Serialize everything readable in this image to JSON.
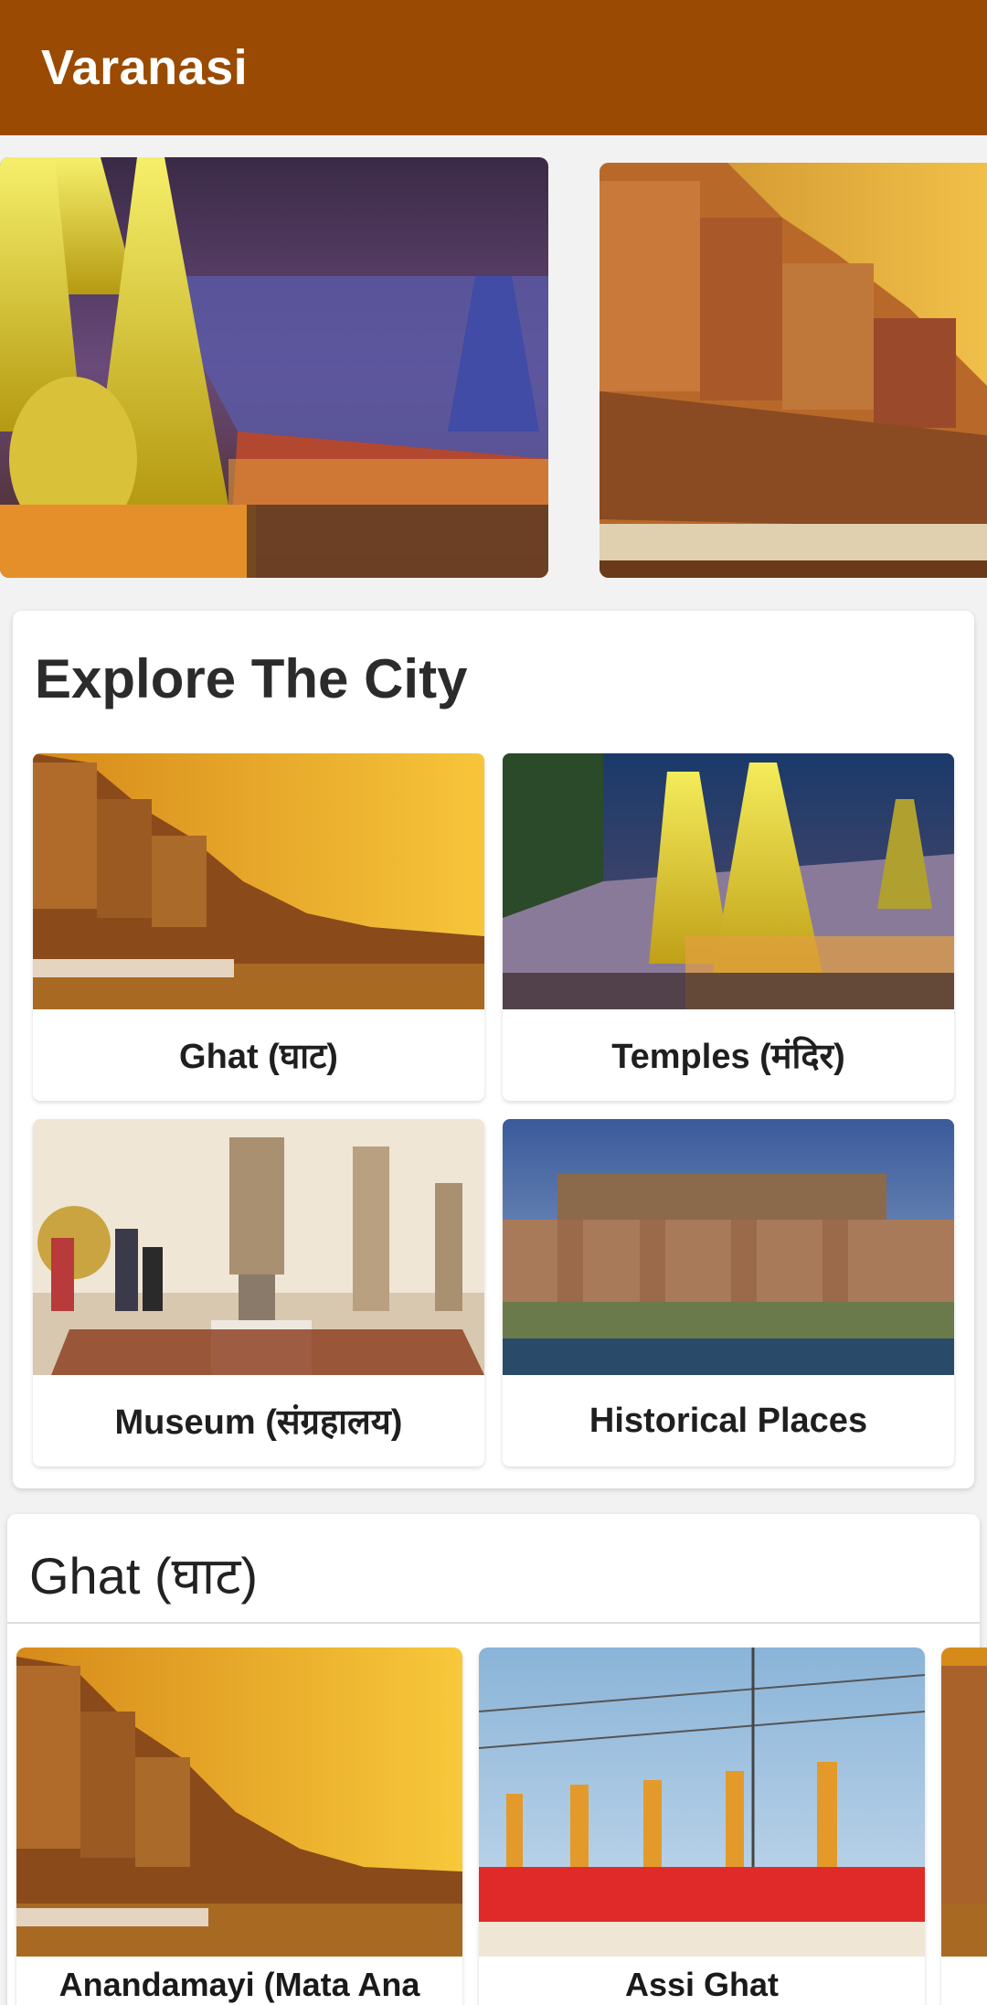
{
  "app_bar": {
    "title": "Varanasi"
  },
  "carousel": {
    "slides": [
      {
        "icon": "temple-night-photo"
      },
      {
        "icon": "ghat-buildings-photo"
      }
    ]
  },
  "explore": {
    "title": "Explore The City",
    "tiles": [
      {
        "label": "Ghat (घाट)",
        "icon": "ghat-photo"
      },
      {
        "label": "Temples (मंदिर)",
        "icon": "temple-photo"
      },
      {
        "label": "Museum (संग्रहालय)",
        "icon": "museum-photo"
      },
      {
        "label": "Historical Places",
        "icon": "fort-photo"
      }
    ]
  },
  "ghat_section": {
    "title": "Ghat (घाट)",
    "items": [
      {
        "label": "Anandamayi (Mata Ana",
        "icon": "ghat-photo"
      },
      {
        "label": "Assi Ghat",
        "icon": "aarti-photo"
      },
      {
        "label": "",
        "icon": "ghat-photo"
      }
    ]
  },
  "colors": {
    "app_bar": "#9a4a02",
    "background": "#f2f2f2"
  }
}
